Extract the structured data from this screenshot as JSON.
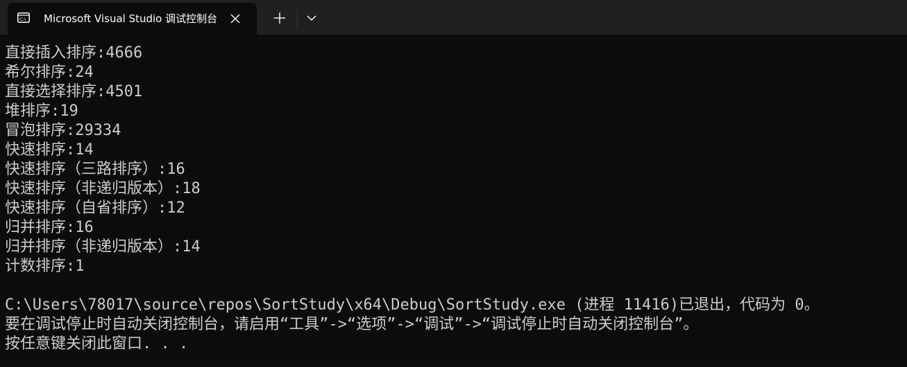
{
  "tab": {
    "title": "Microsoft Visual Studio 调试控制台",
    "icon": "console-app-icon"
  },
  "tab_controls": {
    "new_tab_icon": "plus-icon",
    "dropdown_icon": "chevron-down-icon"
  },
  "colors": {
    "tabstrip_bg": "#202020",
    "console_bg": "#0c0c0c",
    "console_text": "#cccccc"
  },
  "console": {
    "results": [
      "直接插入排序:4666",
      "希尔排序:24",
      "直接选择排序:4501",
      "堆排序:19",
      "冒泡排序:29334",
      "快速排序:14",
      "快速排序（三路排序）:16",
      "快速排序（非递归版本）:18",
      "快速排序（自省排序）:12",
      "归并排序:16",
      "归并排序（非递归版本）:14",
      "计数排序:1"
    ],
    "exit_message": "C:\\Users\\78017\\source\\repos\\SortStudy\\x64\\Debug\\SortStudy.exe (进程 11416)已退出，代码为 0。",
    "hint_message": "要在调试停止时自动关闭控制台，请启用“工具”->“选项”->“调试”->“调试停止时自动关闭控制台”。",
    "press_key_message": "按任意键关闭此窗口. . ."
  }
}
